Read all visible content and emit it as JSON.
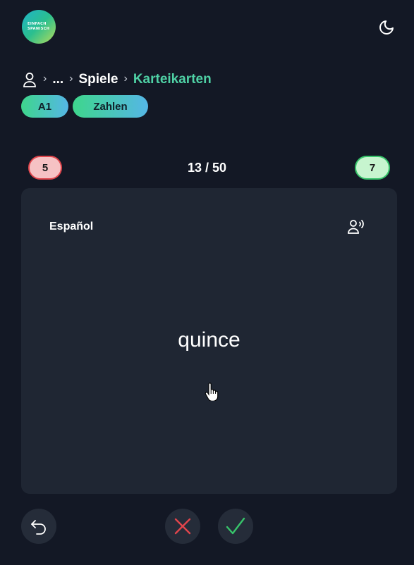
{
  "header": {
    "logo_line1": "EINFACH",
    "logo_line2": "SPANISCH",
    "theme_toggle_icon": "moon-icon"
  },
  "breadcrumb": {
    "home_icon": "user-icon",
    "ellipsis": "...",
    "items": [
      {
        "label": "Spiele"
      },
      {
        "label": "Karteikarten"
      }
    ]
  },
  "tags": [
    {
      "label": "A1"
    },
    {
      "label": "Zahlen"
    }
  ],
  "progress": {
    "wrong_count": "5",
    "right_count": "7",
    "position_text": "13 / 50",
    "current": 13,
    "total": 50
  },
  "card": {
    "language": "Español",
    "word": "quince",
    "speak_icon": "speaker-person-icon"
  },
  "actions": {
    "undo_icon": "undo-icon",
    "wrong_icon": "x-icon",
    "right_icon": "check-icon"
  },
  "colors": {
    "background": "#131825",
    "card": "#1f2633",
    "accent": "#4fd1a5",
    "wrong": "#e0454c",
    "right": "#37c46a"
  }
}
